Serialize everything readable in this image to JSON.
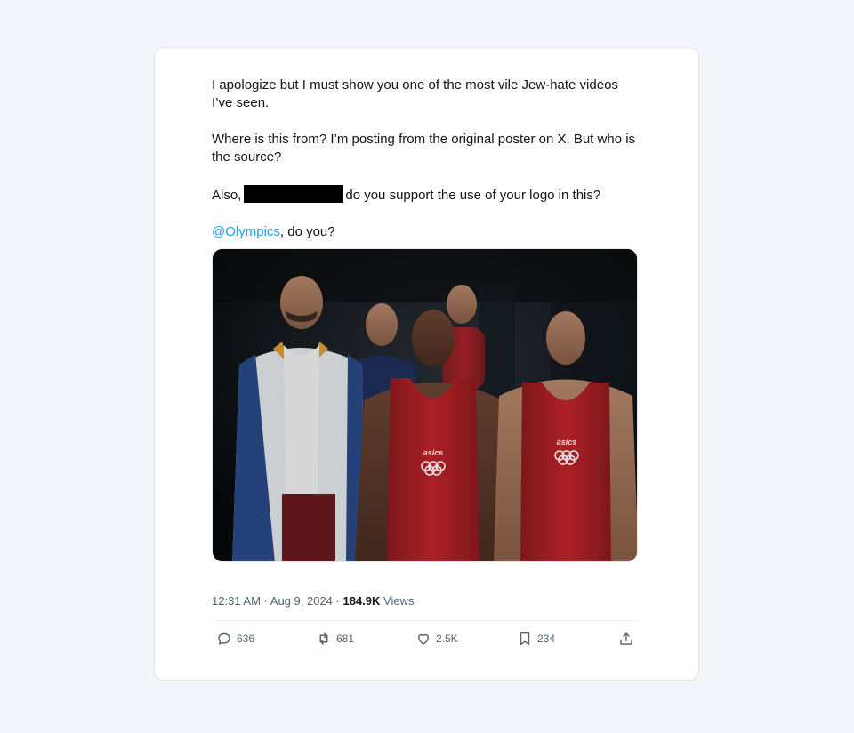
{
  "tweet": {
    "p1": "I apologize but I must show you one of the most vile Jew-hate videos I’ve seen.",
    "p2": "Where is this from? I’m posting from the original poster on X. But who is the source?",
    "p3_before": "Also,",
    "p3_after": "do you support the use of your logo in this?",
    "mention": "@Olympics",
    "p4_after": ", do you?"
  },
  "media": {
    "singlet_text": "asics"
  },
  "meta": {
    "time": "12:31 AM",
    "sep1": " · ",
    "date": "Aug 9, 2024",
    "sep2": " · ",
    "views_count": "184.9K",
    "views_label": " Views"
  },
  "actions": {
    "reply_icon": "reply-icon",
    "replies": "636",
    "retweet_icon": "retweet-icon",
    "retweets": "681",
    "like_icon": "heart-icon",
    "likes": "2.5K",
    "bookmark_icon": "bookmark-icon",
    "bookmarks": "234",
    "share_icon": "share-icon"
  },
  "colors": {
    "background": "#f3f5fa",
    "card": "#ffffff",
    "text": "#0f1419",
    "muted": "#536471",
    "link": "#1d9bf0",
    "singlet_red": "#c4252a"
  }
}
